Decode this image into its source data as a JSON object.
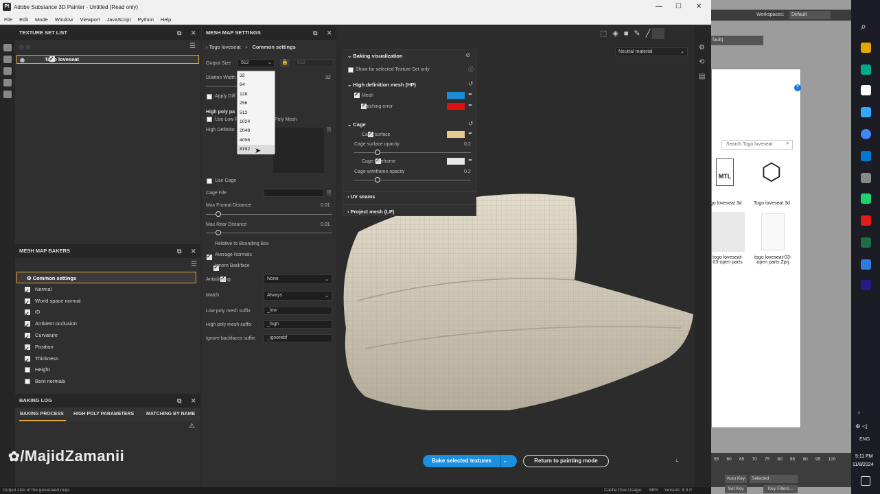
{
  "app": {
    "title": "Adobe Substance 3D Painter - Untitled (Read only)",
    "logo": "Pt",
    "menu": [
      "File",
      "Edit",
      "Mode",
      "Window",
      "Viewport",
      "JavaScript",
      "Python",
      "Help"
    ]
  },
  "texture_set_list": {
    "title": "TEXTURE SET LIST",
    "item": "Togo loveseat"
  },
  "mesh_map_bakers": {
    "title": "MESH MAP BAKERS",
    "items": [
      {
        "label": "Common settings",
        "checked": null
      },
      {
        "label": "Normal",
        "checked": true
      },
      {
        "label": "World space normal",
        "checked": true
      },
      {
        "label": "ID",
        "checked": true
      },
      {
        "label": "Ambient occlusion",
        "checked": true
      },
      {
        "label": "Curvature",
        "checked": true
      },
      {
        "label": "Position",
        "checked": true
      },
      {
        "label": "Thickness",
        "checked": true
      },
      {
        "label": "Height",
        "checked": false
      },
      {
        "label": "Bent normals",
        "checked": false
      }
    ]
  },
  "baking_log": {
    "title": "BAKING LOG",
    "tabs": [
      "BAKING PROCESS",
      "HIGH POLY PARAMETERS",
      "MATCHING BY NAME"
    ]
  },
  "mesh_map_settings": {
    "title": "MESH MAP SETTINGS",
    "breadcrumb": [
      "Togo loveseat",
      "Common settings"
    ],
    "output_size_label": "Output Size",
    "output_size": "512",
    "output_size_linked": "512",
    "dilation_label": "Dilation Width",
    "dilation_value": "32",
    "apply_diffusion": "Apply Diff",
    "high_poly_head": "High poly pa",
    "use_low_poly": "Use Low P",
    "use_low_poly_tail": "Poly Mesh",
    "high_def_label": "High Definitio",
    "use_cage": "Use Cage",
    "cage_file": "Cage File",
    "max_frontal": "Max Frontal Distance",
    "max_frontal_value": "0.01",
    "max_frontal_level": 0.1,
    "max_rear": "Max Rear Distance",
    "max_rear_value": "0.01",
    "max_rear_level": 0.1,
    "relative_bbox": "Relative to Bounding Box",
    "average_normals": "Average Normals",
    "ignore_backface": "Ignore Backface",
    "antialiasing_label": "Antialiasing",
    "antialiasing": "None",
    "match_label": "Match",
    "match": "Always",
    "low_suffix_label": "Low poly mesh suffix",
    "low_suffix": "_low",
    "high_suffix_label": "High poly mesh suffix",
    "high_suffix": "_high",
    "ignore_suffix_label": "Ignore backfaces suffix",
    "ignore_suffix": "_ignorebf",
    "dropdown_options": [
      "32",
      "64",
      "128",
      "256",
      "512",
      "1024",
      "2048",
      "4096",
      "8192"
    ]
  },
  "viewport": {
    "material": "Neutral material",
    "bake_button": "Bake selected textures",
    "return_button": "Return to painting mode"
  },
  "baking_visualization": {
    "title": "Baking visualization",
    "show_selected": "Show for selected Texture Set only",
    "hp_title": "High definition mesh (HP)",
    "mesh": "Mesh",
    "mesh_color": "#1a8fd8",
    "matching_error": "Matching error",
    "matching_color": "#e01010",
    "cage_title": "Cage",
    "cage_surface": "Cage surface",
    "cage_surface_color": "#e6c98e",
    "cage_surface_opacity": "Cage surface opacity",
    "cage_surface_opacity_value": "0.2",
    "cage_wireframe": "Cage wireframe",
    "cage_wireframe_color": "#e8e8e8",
    "cage_wireframe_opacity": "Cage wireframe opacity",
    "cage_wireframe_opacity_value": "0.2",
    "uv_seams": "UV seams",
    "project_mesh": "Project mesh (LP)"
  },
  "status": {
    "hint": "Output size of the generated map.",
    "cache": "Cache Disk Usage:",
    "cache_value": "68%",
    "version": "Version: 8.3.0"
  },
  "background_window": {
    "workspaces": "Workspaces:",
    "workspace_value": "Default",
    "default_field": "fault)",
    "search_placeholder": "Search Togo loveseat",
    "files": [
      {
        "name": "go loveseat 3d",
        "icon": "MTL"
      },
      {
        "name": "Togo loveseat 3d",
        "icon": "cube"
      },
      {
        "name": "togo loveseat-03-open parts",
        "icon": "thumb"
      },
      {
        "name": "togo loveseat-03-open parts.Zprj",
        "icon": "doc"
      }
    ],
    "auto_key": "Auto Key",
    "set_key": "Set Key",
    "selected": "Selected",
    "key_filters": "Key Filters...",
    "timeline": [
      "55",
      "60",
      "65",
      "70",
      "75",
      "80",
      "85",
      "90",
      "95",
      "100"
    ]
  },
  "watermark": "/MajidZamanii",
  "taskbar": {
    "time": "5:11 PM",
    "date": "11/8/2024",
    "lang": "ENG"
  }
}
